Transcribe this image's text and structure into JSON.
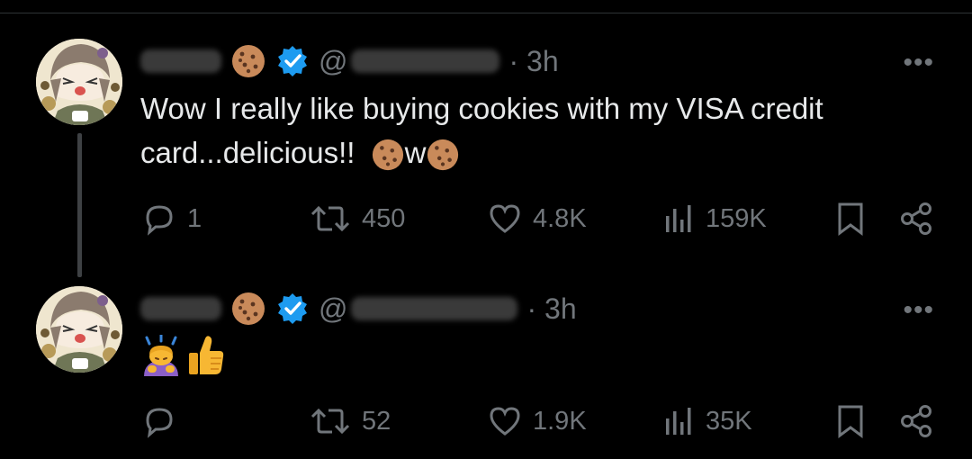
{
  "tweets": [
    {
      "handle_prefix": "@",
      "time": "· 3h",
      "more": "•••",
      "text": "Wow I really like buying cookies with my VISA credit card...delicious!!",
      "text_tail": "w",
      "actions": {
        "reply": "1",
        "retweet": "450",
        "like": "4.8K",
        "views": "159K"
      }
    },
    {
      "handle_prefix": "@",
      "time": "· 3h",
      "more": "•••",
      "emojis": [
        "person-bowing-emoji",
        "thumbs-up-emoji"
      ],
      "actions": {
        "reply": "",
        "retweet": "52",
        "like": "1.9K",
        "views": "35K"
      }
    }
  ],
  "colors": {
    "background": "#000000",
    "text": "#e7e9ea",
    "muted": "#71767b",
    "verified": "#1d9bf0"
  }
}
